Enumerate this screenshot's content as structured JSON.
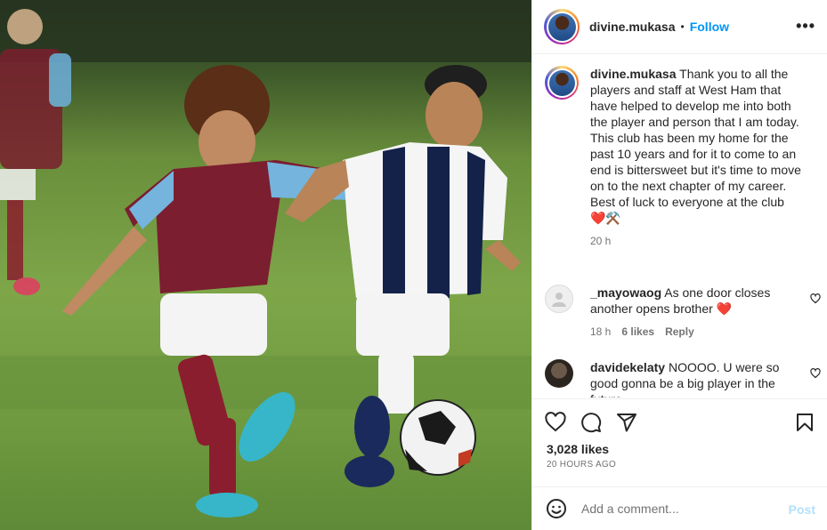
{
  "header": {
    "username": "divine.mukasa",
    "separator": "•",
    "follow_label": "Follow",
    "more_label": "•••"
  },
  "caption": {
    "username": "divine.mukasa",
    "text": "Thank you to all the players and staff at West Ham that have helped to develop me into both the player and person that I am today. This club has been my home for the past 10 years and for it to come to an end is bittersweet but it's time to move on to the next chapter of my career.",
    "text2": "Best of luck to everyone at the club",
    "emoji": "❤️⚒️",
    "time": "20 h"
  },
  "comments": [
    {
      "username": "_mayowaog",
      "text": "As one door closes another opens brother ❤️",
      "time": "18 h",
      "likes": "6 likes",
      "reply": "Reply"
    },
    {
      "username": "davidekelaty",
      "text": "NOOOO. U were so good gonna be a big player in the future",
      "time": "",
      "likes": "",
      "reply": ""
    }
  ],
  "actions": {
    "icons": [
      "heart-icon",
      "comment-icon",
      "share-icon",
      "save-icon"
    ],
    "likes": "3,028 likes",
    "ago": "20 HOURS AGO"
  },
  "add_comment": {
    "placeholder": "Add a comment...",
    "post_label": "Post",
    "emoji_icon": "smiley-icon"
  },
  "colors": {
    "link": "#0095f6",
    "post_disabled": "#b2dffc",
    "muted": "#737373",
    "text": "#262626"
  }
}
